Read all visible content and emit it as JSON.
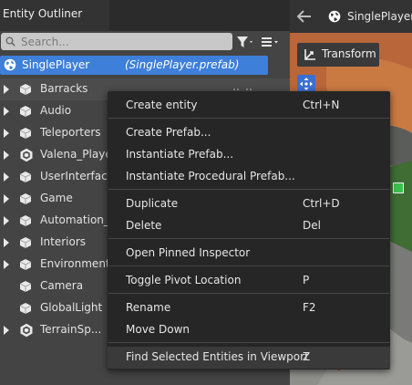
{
  "outliner": {
    "tab_title": "Entity Outliner",
    "search_placeholder": "Search...",
    "root": {
      "label": "SinglePlayer",
      "prefab": "(SinglePlayer.prefab)"
    },
    "entities": [
      {
        "label": "Barracks",
        "icon": "cube-icon",
        "expandable": true
      },
      {
        "label": "Audio",
        "icon": "cube-icon",
        "expandable": true
      },
      {
        "label": "Teleporters",
        "icon": "cube-icon",
        "expandable": true
      },
      {
        "label": "Valena_Playe",
        "icon": "prefab-hex-icon",
        "expandable": true
      },
      {
        "label": "UserInterface",
        "icon": "cube-icon",
        "expandable": true
      },
      {
        "label": "Game",
        "icon": "cube-icon",
        "expandable": true
      },
      {
        "label": "Automation_T",
        "icon": "cube-icon",
        "expandable": true
      },
      {
        "label": "Interiors",
        "icon": "cube-icon",
        "expandable": true
      },
      {
        "label": "Environment",
        "icon": "cube-icon",
        "expandable": true
      },
      {
        "label": "Camera",
        "icon": "cube-icon",
        "expandable": false
      },
      {
        "label": "GlobalLight",
        "icon": "cube-icon",
        "expandable": false
      },
      {
        "label": "TerrainSp...",
        "icon": "prefab-hex-icon",
        "expandable": true
      }
    ]
  },
  "viewport": {
    "title": "SinglePlayer...",
    "transform_label": "Transform"
  },
  "context_menu": {
    "items": [
      {
        "label": "Create entity",
        "shortcut": "Ctrl+N"
      },
      {
        "label": "Create Prefab...",
        "shortcut": ""
      },
      {
        "label": "Instantiate Prefab...",
        "shortcut": ""
      },
      {
        "label": "Instantiate Procedural Prefab...",
        "shortcut": ""
      },
      {
        "label": "Duplicate",
        "shortcut": "Ctrl+D"
      },
      {
        "label": "Delete",
        "shortcut": "Del"
      },
      {
        "label": "Open Pinned Inspector",
        "shortcut": ""
      },
      {
        "label": "Toggle Pivot Location",
        "shortcut": "P"
      },
      {
        "label": "Rename",
        "shortcut": "F2"
      },
      {
        "label": "Move Down",
        "shortcut": ""
      },
      {
        "label": "Find Selected Entities in Viewport",
        "shortcut": "Z"
      }
    ]
  },
  "colors": {
    "panel_bg": "#444444",
    "selection_blue": "#3d7fd9",
    "menu_bg": "#262626",
    "menu_hover": "#3a3a3a"
  }
}
